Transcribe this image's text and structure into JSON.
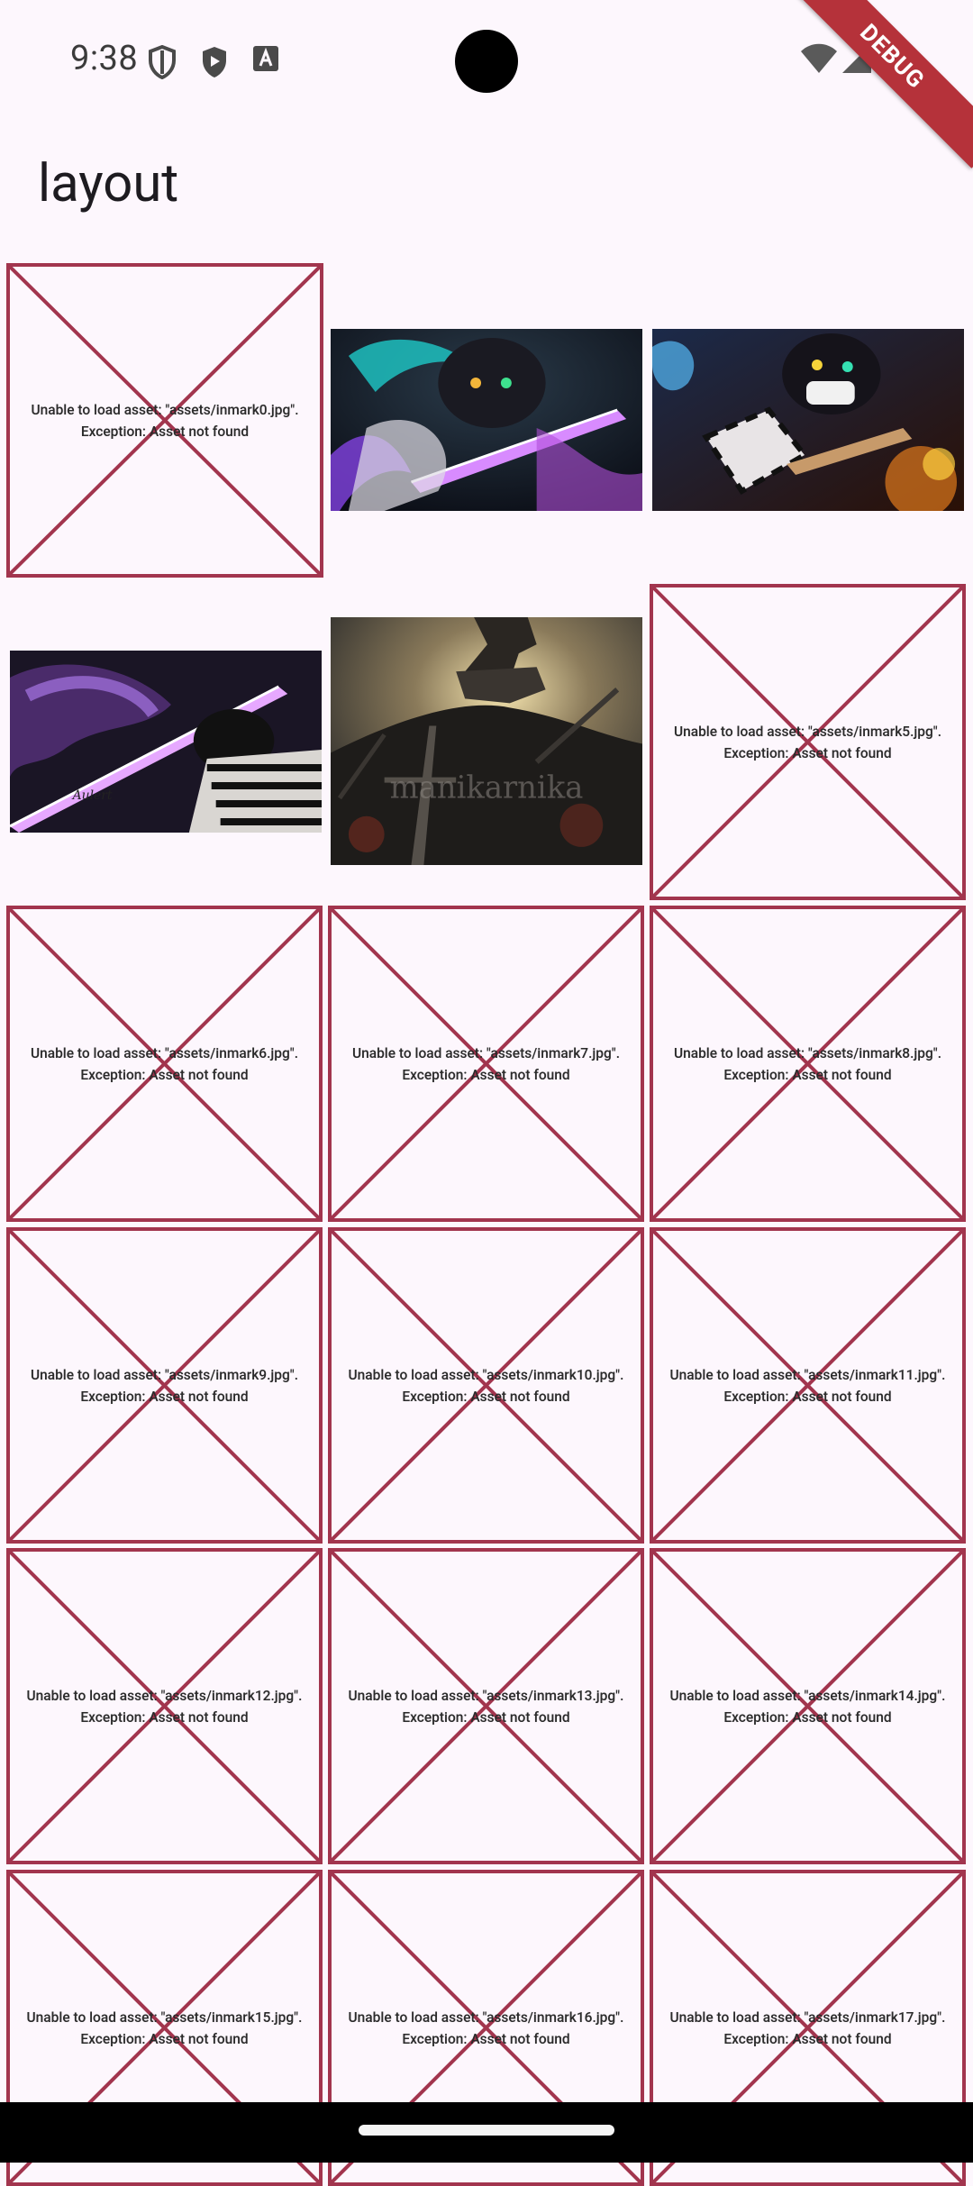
{
  "status_bar": {
    "time": "9:38",
    "left_icons": [
      "shield-outline-icon",
      "play-shield-icon",
      "font-a-icon"
    ],
    "right_icons": [
      "wifi-icon",
      "cellular-signal-icon",
      "battery-icon"
    ]
  },
  "debug_banner": "DEBUG",
  "app_bar": {
    "title": "layout"
  },
  "colors": {
    "error_border": "#a2354e",
    "background": "#fdf7fd"
  },
  "images": [
    {
      "name": "image-0",
      "status": "error",
      "line1": "Unable to load asset: \"assets/inmark0.jpg\".",
      "line2": "Exception: Asset not found"
    },
    {
      "name": "image-1",
      "status": "loaded",
      "description": "anime swordsman with purple blade"
    },
    {
      "name": "image-2",
      "status": "loaded",
      "description": "masked anime fighter with sword"
    },
    {
      "name": "image-3",
      "status": "loaded",
      "description": "swordsman facing serpent with purple blade",
      "signature": "Aulert"
    },
    {
      "name": "image-4",
      "status": "loaded",
      "description": "rider on horse over battlefield",
      "watermark": "manikarnika"
    },
    {
      "name": "image-5",
      "status": "error",
      "line1": "Unable to load asset: \"assets/inmark5.jpg\".",
      "line2": "Exception: Asset not found"
    },
    {
      "name": "image-6",
      "status": "error",
      "line1": "Unable to load asset: \"assets/inmark6.jpg\".",
      "line2": "Exception: Asset not found"
    },
    {
      "name": "image-7",
      "status": "error",
      "line1": "Unable to load asset: \"assets/inmark7.jpg\".",
      "line2": "Exception: Asset not found"
    },
    {
      "name": "image-8",
      "status": "error",
      "line1": "Unable to load asset: \"assets/inmark8.jpg\".",
      "line2": "Exception: Asset not found"
    },
    {
      "name": "image-9",
      "status": "error",
      "line1": "Unable to load asset: \"assets/inmark9.jpg\".",
      "line2": "Exception: Asset not found"
    },
    {
      "name": "image-10",
      "status": "error",
      "line1": "Unable to load asset: \"assets/inmark10.jpg\".",
      "line2": "Exception: Asset not found"
    },
    {
      "name": "image-11",
      "status": "error",
      "line1": "Unable to load asset: \"assets/inmark11.jpg\".",
      "line2": "Exception: Asset not found"
    },
    {
      "name": "image-12",
      "status": "error",
      "line1": "Unable to load asset: \"assets/inmark12.jpg\".",
      "line2": "Exception: Asset not found"
    },
    {
      "name": "image-13",
      "status": "error",
      "line1": "Unable to load asset: \"assets/inmark13.jpg\".",
      "line2": "Exception: Asset not found"
    },
    {
      "name": "image-14",
      "status": "error",
      "line1": "Unable to load asset: \"assets/inmark14.jpg\".",
      "line2": "Exception: Asset not found"
    },
    {
      "name": "image-15",
      "status": "error",
      "line1": "Unable to load asset: \"assets/inmark15.jpg\".",
      "line2": "Exception: Asset not found"
    },
    {
      "name": "image-16",
      "status": "error",
      "line1": "Unable to load asset: \"assets/inmark16.jpg\".",
      "line2": "Exception: Asset not found"
    },
    {
      "name": "image-17",
      "status": "error",
      "line1": "Unable to load asset: \"assets/inmark17.jpg\".",
      "line2": "Exception: Asset not found"
    }
  ],
  "nav_bar": {
    "handle": "gesture-handle"
  }
}
